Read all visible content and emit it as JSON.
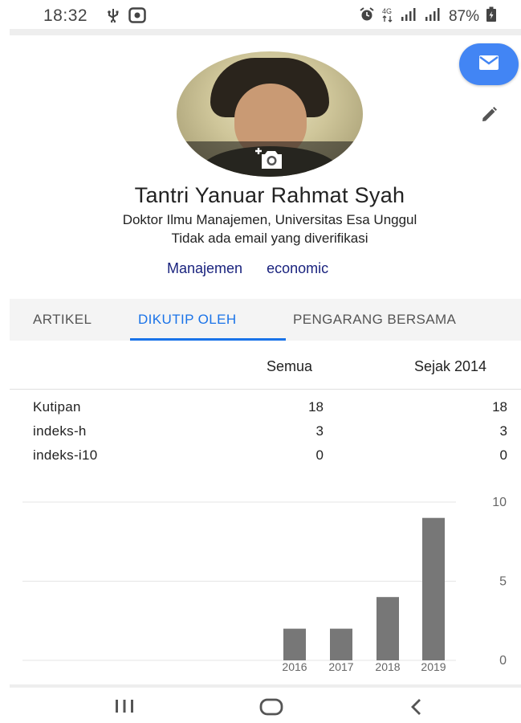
{
  "status_bar": {
    "time": "18:32",
    "left_icons": [
      "usb-icon",
      "screen-record-icon"
    ],
    "right_icons": [
      "alarm-icon",
      "data-4g-icon",
      "signal-icon",
      "signal-icon"
    ],
    "battery": "87%"
  },
  "profile": {
    "name": "Tantri Yanuar Rahmat Syah",
    "affiliation": "Doktor Ilmu Manajemen, Universitas Esa Unggul",
    "email_status": "Tidak ada email yang diverifikasi",
    "interests": [
      "Manajemen",
      "economic"
    ],
    "avatar_icon": "camera-add-icon",
    "mail_icon": "mail-icon",
    "edit_icon": "pencil-icon"
  },
  "tabs": [
    {
      "label": "ARTIKEL",
      "active": false
    },
    {
      "label": "DIKUTIP OLEH",
      "active": true
    },
    {
      "label": "PENGARANG BERSAMA",
      "active": false
    }
  ],
  "stats": {
    "headers": {
      "all": "Semua",
      "since": "Sejak 2014"
    },
    "rows": [
      {
        "label": "Kutipan",
        "all": "18",
        "since": "18"
      },
      {
        "label": "indeks-h",
        "all": "3",
        "since": "3"
      },
      {
        "label": "indeks-i10",
        "all": "0",
        "since": "0"
      }
    ]
  },
  "chart_data": {
    "type": "bar",
    "categories": [
      "2016",
      "2017",
      "2018",
      "2019"
    ],
    "values": [
      2,
      2,
      4,
      9
    ],
    "ylim": [
      0,
      10
    ],
    "yticks": [
      "0",
      "5",
      "10"
    ],
    "title": "",
    "xlabel": "",
    "ylabel": "",
    "grid": true,
    "bar_color": "#777777"
  },
  "colors": {
    "accent": "#1a73e8",
    "fab": "#4285f4",
    "interest_link": "#1a237e"
  },
  "nav": {
    "icons": [
      "recent-apps-icon",
      "home-icon",
      "back-icon"
    ]
  }
}
